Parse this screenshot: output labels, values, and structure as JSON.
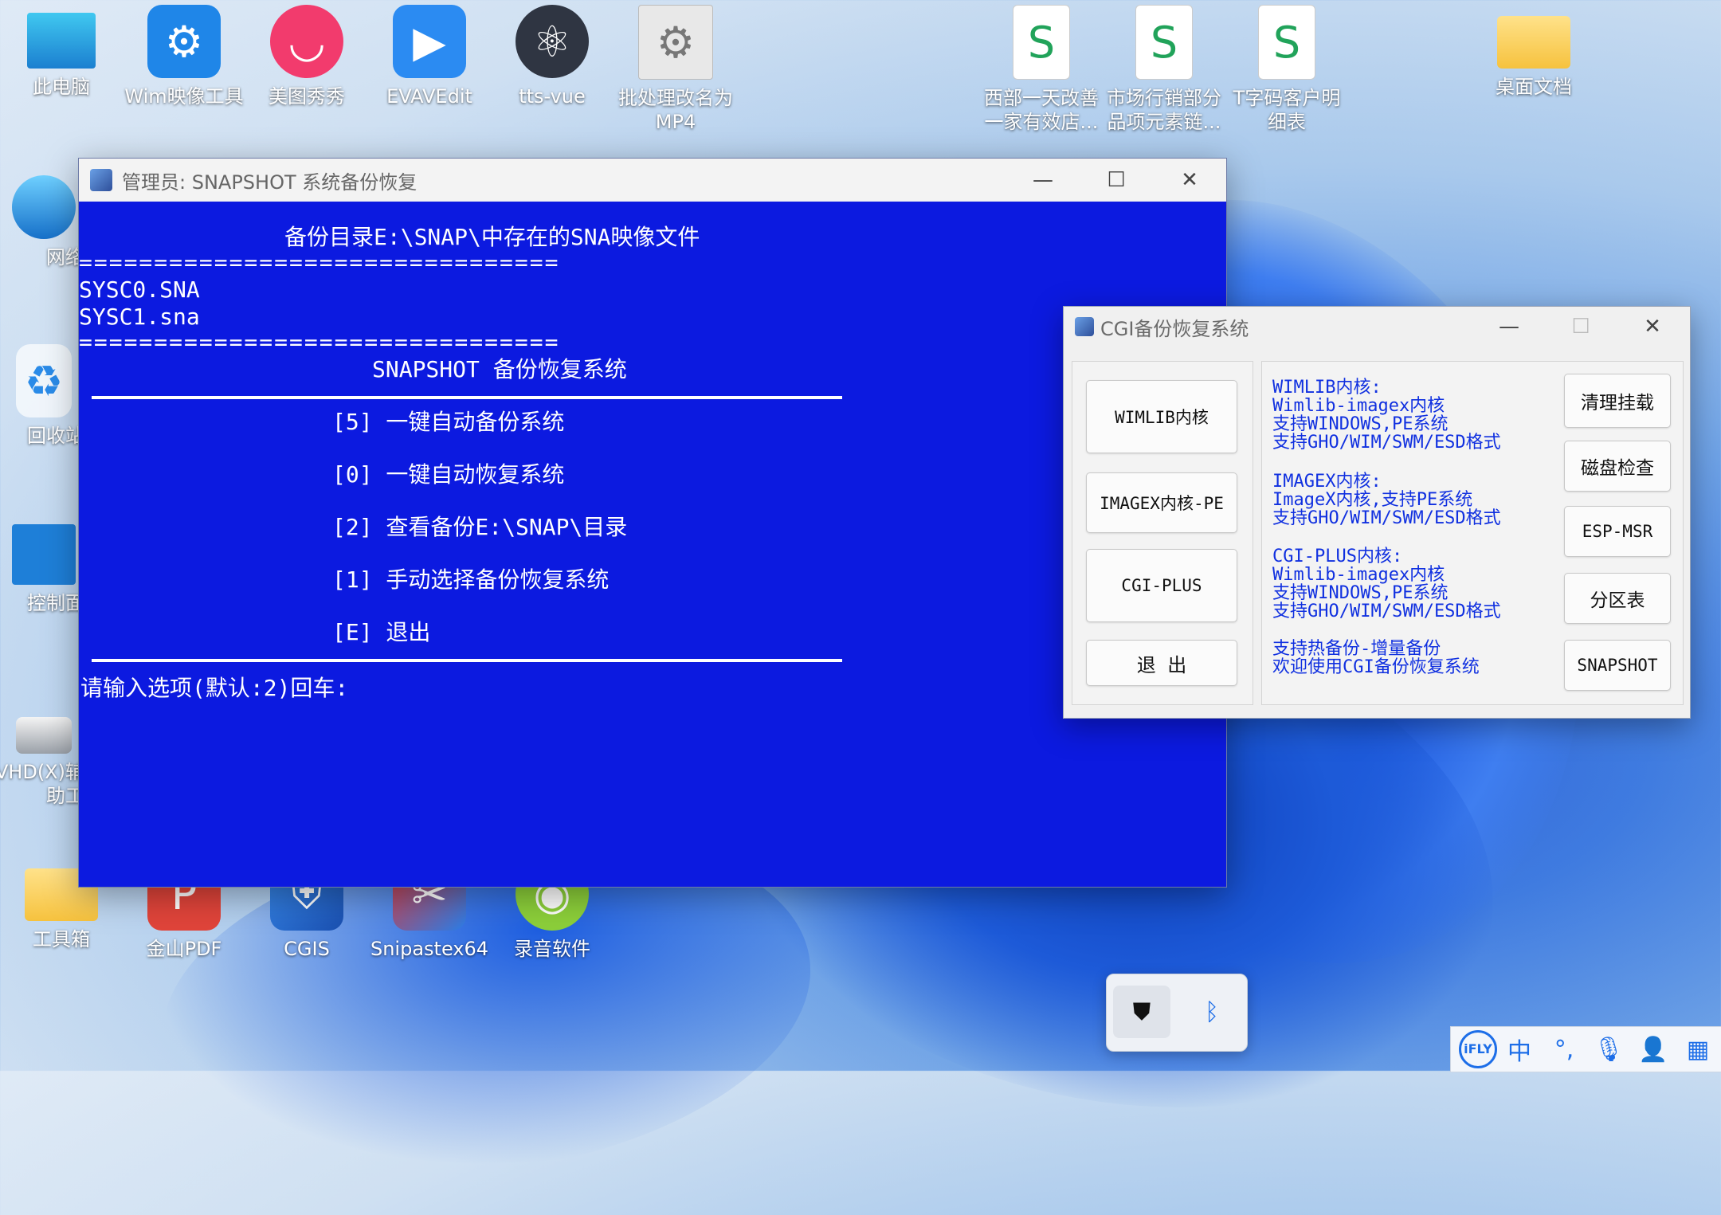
{
  "desktop": {
    "icons": [
      {
        "label": "此电脑"
      },
      {
        "label": "Wim映像工具"
      },
      {
        "label": "美图秀秀"
      },
      {
        "label": "EVAVEdit"
      },
      {
        "label": "tts-vue"
      },
      {
        "label": "批处理改名为MP4"
      },
      {
        "label": "西部一天改善一家有效店..."
      },
      {
        "label": "市场行销部分品项元素链..."
      },
      {
        "label": "T字码客户明细表"
      },
      {
        "label": "桌面文档"
      },
      {
        "label": "网络"
      },
      {
        "label": "回收站"
      },
      {
        "label": "控制面"
      },
      {
        "label": "VHD(X)辅助工"
      },
      {
        "label": "工具箱"
      },
      {
        "label": "金山PDF"
      },
      {
        "label": "CGIS"
      },
      {
        "label": "Snipastex64"
      },
      {
        "label": "录音软件"
      }
    ]
  },
  "console_window": {
    "title": "管理员:  SNAPSHOT 系统备份恢复",
    "lines": {
      "dir_heading": "备份目录E:\\SNAP\\中存在的SNA映像文件",
      "rule": "================================",
      "file1": "SYSC0.SNA",
      "file2": "SYSC1.sna",
      "menu_title": "SNAPSHOT 备份恢复系统",
      "opt5": "[5] 一键自动备份系统",
      "opt0": "[0] 一键自动恢复系统",
      "opt2": "[2] 查看备份E:\\SNAP\\目录",
      "opt1": "[1] 手动选择备份恢复系统",
      "optE": "[E] 退出",
      "prompt": "请输入选项(默认:2)回车:"
    }
  },
  "cgi_window": {
    "title": "CGI备份恢复系统",
    "left_buttons": [
      "WIMLIB内核",
      "IMAGEX内核-PE",
      "CGI-PLUS",
      "退 出"
    ],
    "right_buttons": [
      "清理挂载",
      "磁盘检查",
      "ESP-MSR",
      "分区表",
      "SNAPSHOT"
    ],
    "info": {
      "wimlib": "WIMLIB内核:\nWimlib-imagex内核\n支持WINDOWS,PE系统\n支持GHO/WIM/SWM/ESD格式",
      "imagex": "IMAGEX内核:\nImageX内核,支持PE系统\n支持GHO/WIM/SWM/ESD格式",
      "cgiplus": "CGI-PLUS内核:\nWimlib-imagex内核\n支持WINDOWS,PE系统\n支持GHO/WIM/SWM/ESD格式",
      "footer": "支持热备份-增量备份\n欢迎使用CGI备份恢复系统"
    }
  },
  "ime_bar": {
    "logo": "iFLY",
    "mode": "中"
  },
  "colors": {
    "console_bg": "#0c1ae0",
    "info_text": "#1030e0"
  }
}
